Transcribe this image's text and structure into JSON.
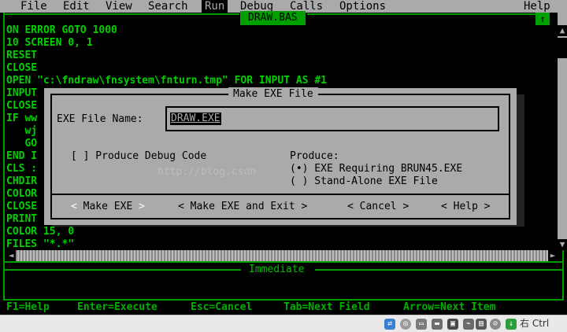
{
  "menubar": {
    "items": [
      "File",
      "Edit",
      "View",
      "Search",
      "Run",
      "Debug",
      "Calls",
      "Options",
      "Help"
    ],
    "active": "Run"
  },
  "editor": {
    "title": "DRAW.BAS",
    "max_glyph": "↑",
    "lines": [
      "ON ERROR GOTO 1000",
      "10 SCREEN 0, 1",
      "RESET",
      "CLOSE",
      "OPEN \"c:\\fndraw\\fnsystem\\fnturn.tmp\" FOR INPUT AS #1",
      "INPUT",
      "CLOSE",
      "IF ww",
      "   wj",
      "   GO",
      "END I",
      "CLS :",
      "CHDIR",
      "COLOR",
      "CLOSE",
      "PRINT",
      "COLOR 15, 0",
      "FILES \"*.*\""
    ]
  },
  "dialog": {
    "title": "Make EXE File",
    "exe_label": "EXE File Name:",
    "exe_value": "DRAW.EXE",
    "debug_checkbox": "[ ] Produce Debug Code",
    "produce_label": "Produce:",
    "option_brun": "(•) EXE Requiring BRUN45.EXE",
    "option_standalone": "( ) Stand-Alone EXE File",
    "watermark": "http://blog.csdn",
    "buttons": {
      "make_exe": "Make EXE",
      "make_exe_exit": "Make EXE and Exit",
      "cancel": "Cancel",
      "help": "Help"
    }
  },
  "immediate": {
    "title": "Immediate"
  },
  "statusbar": {
    "items": [
      "F1=Help",
      "Enter=Execute",
      "Esc=Cancel",
      "Tab=Next Field",
      "Arrow=Next Item"
    ]
  },
  "taskbar": {
    "ime": "右 Ctrl",
    "icons": [
      "network-icon",
      "cd-icon",
      "disk-icon",
      "folder-icon",
      "display-icon",
      "usb-icon",
      "shared-folder-icon",
      "mouse-icon",
      "download-icon"
    ]
  },
  "colors": {
    "code_green": "#00d000",
    "frame_green": "#009f00",
    "dialog_gray": "#aaaaaa"
  }
}
